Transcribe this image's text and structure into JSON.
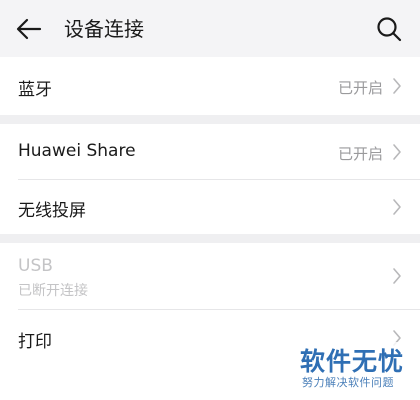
{
  "header": {
    "back_icon": "back-arrow-icon",
    "title": "设备连接",
    "search_icon": "search-icon"
  },
  "bluetooth": {
    "label": "蓝牙",
    "status": "已开启"
  },
  "huawei_share": {
    "label": "Huawei Share",
    "status": "已开启"
  },
  "wireless_projection": {
    "label": "无线投屏"
  },
  "usb": {
    "label": "USB",
    "subtitle": "已断开连接"
  },
  "print": {
    "label": "打印"
  },
  "watermark": {
    "logo": "软件无忧",
    "subtitle": "努力解决软件问题"
  },
  "colors": {
    "background": "#efeff1",
    "card": "#ffffff",
    "disabled_text": "#c4c4c6",
    "watermark_blue": "#2f6fb4"
  }
}
